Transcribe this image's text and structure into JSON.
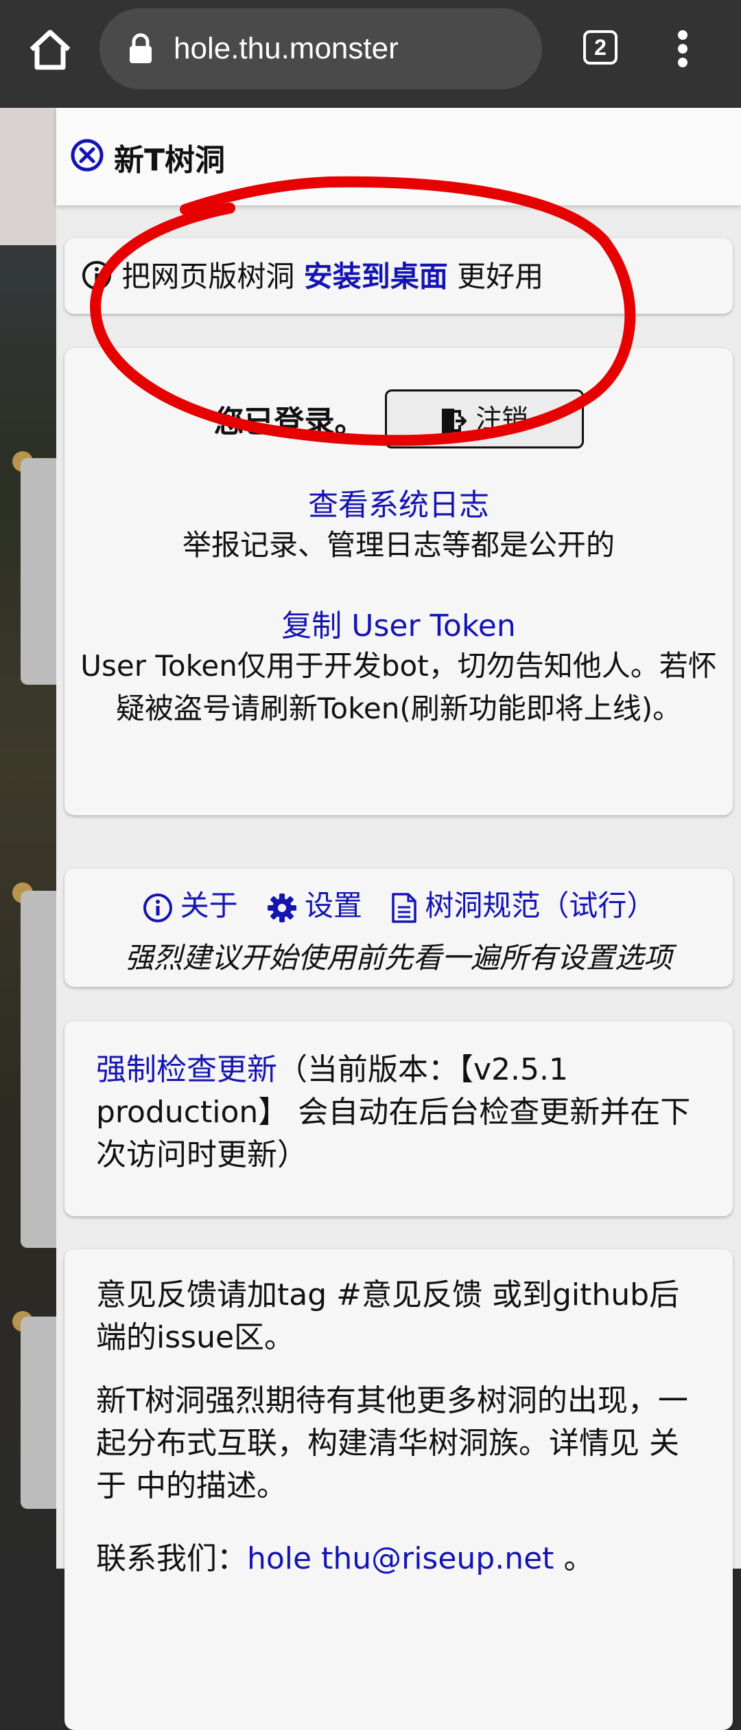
{
  "browser": {
    "url": "hole.thu.monster",
    "tab_count": "2"
  },
  "panel": {
    "title": "新T树洞"
  },
  "install": {
    "prefix": "把网页版树洞",
    "link": "安装到桌面",
    "suffix": "更好用"
  },
  "login": {
    "status": "您已登录。",
    "logout_label": "注销",
    "syslog_link": "查看系统日志",
    "syslog_desc": "举报记录、管理日志等都是公开的",
    "token_link": "复制 User Token",
    "token_desc": "User Token仅用于开发bot，切勿告知他人。若怀疑被盗号请刷新Token(刷新功能即将上线)。"
  },
  "about": {
    "about_label": "关于",
    "settings_label": "设置",
    "rules_label": "树洞规范（试行）",
    "note": "强烈建议开始使用前先看一遍所有设置选项"
  },
  "version": {
    "check_link": "强制检查更新",
    "text": "（当前版本：【v2.5.1 production】 会自动在后台检查更新并在下次访问时更新）"
  },
  "feedback": {
    "p1": "意见反馈请加tag #意见反馈 或到github后端的issue区。",
    "p2": "新T树洞强烈期待有其他更多树洞的出现，一起分布式互联，构建清华树洞族。详情见 关于 中的描述。",
    "contact_prefix": "联系我们：",
    "email": "hole thu@riseup.net",
    "contact_suffix": "。"
  },
  "colors": {
    "link": "#1414b4",
    "annotation": "#e60000"
  }
}
